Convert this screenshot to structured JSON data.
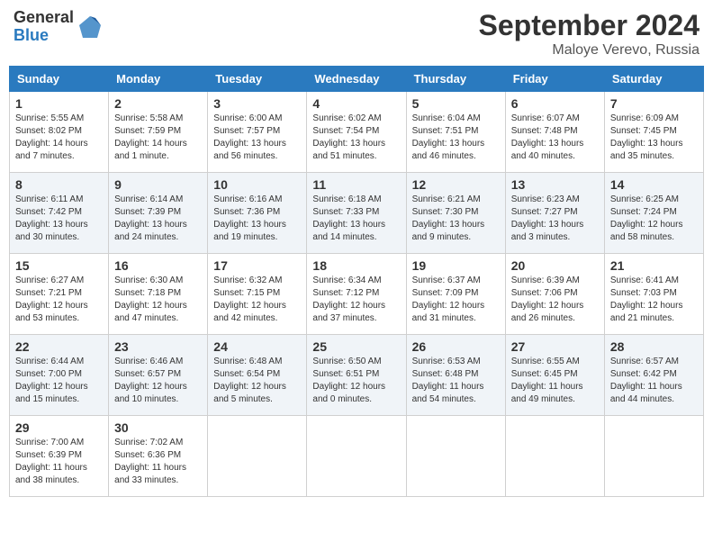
{
  "header": {
    "logo_general": "General",
    "logo_blue": "Blue",
    "month_title": "September 2024",
    "location": "Maloye Verevo, Russia"
  },
  "days_of_week": [
    "Sunday",
    "Monday",
    "Tuesday",
    "Wednesday",
    "Thursday",
    "Friday",
    "Saturday"
  ],
  "weeks": [
    [
      {
        "day": "1",
        "sunrise": "5:55 AM",
        "sunset": "8:02 PM",
        "daylight": "14 hours and 7 minutes."
      },
      {
        "day": "2",
        "sunrise": "5:58 AM",
        "sunset": "7:59 PM",
        "daylight": "14 hours and 1 minute."
      },
      {
        "day": "3",
        "sunrise": "6:00 AM",
        "sunset": "7:57 PM",
        "daylight": "13 hours and 56 minutes."
      },
      {
        "day": "4",
        "sunrise": "6:02 AM",
        "sunset": "7:54 PM",
        "daylight": "13 hours and 51 minutes."
      },
      {
        "day": "5",
        "sunrise": "6:04 AM",
        "sunset": "7:51 PM",
        "daylight": "13 hours and 46 minutes."
      },
      {
        "day": "6",
        "sunrise": "6:07 AM",
        "sunset": "7:48 PM",
        "daylight": "13 hours and 40 minutes."
      },
      {
        "day": "7",
        "sunrise": "6:09 AM",
        "sunset": "7:45 PM",
        "daylight": "13 hours and 35 minutes."
      }
    ],
    [
      {
        "day": "8",
        "sunrise": "6:11 AM",
        "sunset": "7:42 PM",
        "daylight": "13 hours and 30 minutes."
      },
      {
        "day": "9",
        "sunrise": "6:14 AM",
        "sunset": "7:39 PM",
        "daylight": "13 hours and 24 minutes."
      },
      {
        "day": "10",
        "sunrise": "6:16 AM",
        "sunset": "7:36 PM",
        "daylight": "13 hours and 19 minutes."
      },
      {
        "day": "11",
        "sunrise": "6:18 AM",
        "sunset": "7:33 PM",
        "daylight": "13 hours and 14 minutes."
      },
      {
        "day": "12",
        "sunrise": "6:21 AM",
        "sunset": "7:30 PM",
        "daylight": "13 hours and 9 minutes."
      },
      {
        "day": "13",
        "sunrise": "6:23 AM",
        "sunset": "7:27 PM",
        "daylight": "13 hours and 3 minutes."
      },
      {
        "day": "14",
        "sunrise": "6:25 AM",
        "sunset": "7:24 PM",
        "daylight": "12 hours and 58 minutes."
      }
    ],
    [
      {
        "day": "15",
        "sunrise": "6:27 AM",
        "sunset": "7:21 PM",
        "daylight": "12 hours and 53 minutes."
      },
      {
        "day": "16",
        "sunrise": "6:30 AM",
        "sunset": "7:18 PM",
        "daylight": "12 hours and 47 minutes."
      },
      {
        "day": "17",
        "sunrise": "6:32 AM",
        "sunset": "7:15 PM",
        "daylight": "12 hours and 42 minutes."
      },
      {
        "day": "18",
        "sunrise": "6:34 AM",
        "sunset": "7:12 PM",
        "daylight": "12 hours and 37 minutes."
      },
      {
        "day": "19",
        "sunrise": "6:37 AM",
        "sunset": "7:09 PM",
        "daylight": "12 hours and 31 minutes."
      },
      {
        "day": "20",
        "sunrise": "6:39 AM",
        "sunset": "7:06 PM",
        "daylight": "12 hours and 26 minutes."
      },
      {
        "day": "21",
        "sunrise": "6:41 AM",
        "sunset": "7:03 PM",
        "daylight": "12 hours and 21 minutes."
      }
    ],
    [
      {
        "day": "22",
        "sunrise": "6:44 AM",
        "sunset": "7:00 PM",
        "daylight": "12 hours and 15 minutes."
      },
      {
        "day": "23",
        "sunrise": "6:46 AM",
        "sunset": "6:57 PM",
        "daylight": "12 hours and 10 minutes."
      },
      {
        "day": "24",
        "sunrise": "6:48 AM",
        "sunset": "6:54 PM",
        "daylight": "12 hours and 5 minutes."
      },
      {
        "day": "25",
        "sunrise": "6:50 AM",
        "sunset": "6:51 PM",
        "daylight": "12 hours and 0 minutes."
      },
      {
        "day": "26",
        "sunrise": "6:53 AM",
        "sunset": "6:48 PM",
        "daylight": "11 hours and 54 minutes."
      },
      {
        "day": "27",
        "sunrise": "6:55 AM",
        "sunset": "6:45 PM",
        "daylight": "11 hours and 49 minutes."
      },
      {
        "day": "28",
        "sunrise": "6:57 AM",
        "sunset": "6:42 PM",
        "daylight": "11 hours and 44 minutes."
      }
    ],
    [
      {
        "day": "29",
        "sunrise": "7:00 AM",
        "sunset": "6:39 PM",
        "daylight": "11 hours and 38 minutes."
      },
      {
        "day": "30",
        "sunrise": "7:02 AM",
        "sunset": "6:36 PM",
        "daylight": "11 hours and 33 minutes."
      },
      null,
      null,
      null,
      null,
      null
    ]
  ],
  "labels": {
    "sunrise": "Sunrise: ",
    "sunset": "Sunset: ",
    "daylight": "Daylight: "
  }
}
